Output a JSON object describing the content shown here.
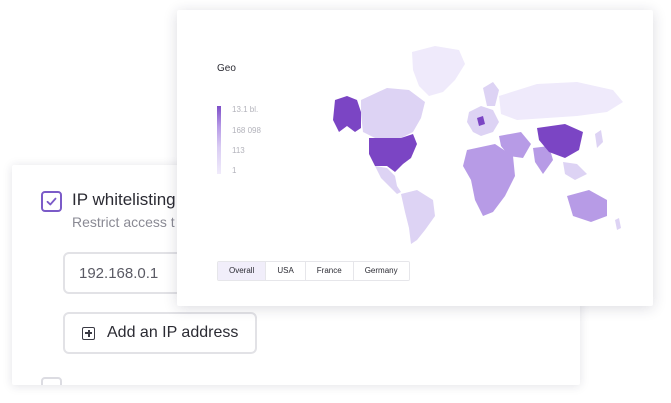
{
  "settings": {
    "ip_whitelisting_title": "IP whitelisting",
    "ip_whitelisting_description": "Restrict access t",
    "ip_input_value": "192.168.0.1",
    "add_ip_label": "Add an IP address",
    "checkbox_checked": true
  },
  "geo": {
    "title": "Geo",
    "legend": [
      "13.1 bl.",
      "168 098",
      "113",
      "1"
    ],
    "tabs": [
      {
        "label": "Overall",
        "active": true
      },
      {
        "label": "USA",
        "active": false
      },
      {
        "label": "France",
        "active": false
      },
      {
        "label": "Germany",
        "active": false
      }
    ]
  },
  "colors": {
    "accent": "#7b5bc8",
    "map_high": "#7b45c4",
    "map_mid": "#b79be6",
    "map_low": "#ddd3f4",
    "map_min": "#efeafb"
  }
}
